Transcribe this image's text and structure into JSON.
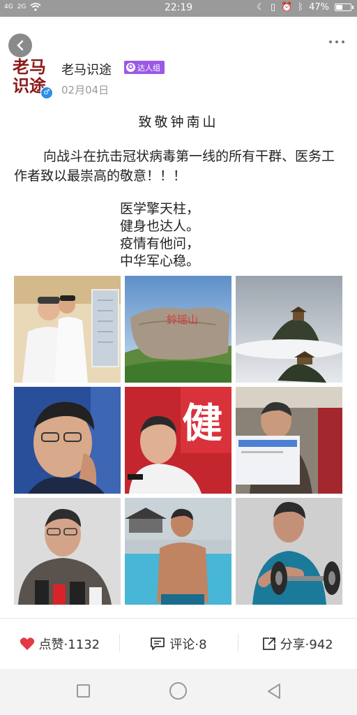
{
  "status_bar": {
    "signal_left": "4G",
    "signal_right": "2G",
    "time": "22:19",
    "battery": "47%",
    "battery_level": 0.47
  },
  "post": {
    "logo_text_line1": "老马",
    "logo_text_line2": "识途",
    "author": "老马识途",
    "badge_label": "达人组",
    "date": "02月04日",
    "title": "致敬钟南山",
    "paragraph": "向战斗在抗击冠状病毒第一线的所有干群、医务工作者致以最崇高的敬意！！！",
    "poem": [
      "医学擎天柱，",
      "健身也达人。",
      "疫情有他问，",
      "中华军心稳。"
    ],
    "photos": [
      "doctor-with-xray-photo",
      "mountain-rock-inscription-photo",
      "misty-mountain-temple-photo",
      "thinking-portrait-photo",
      "smiling-speaker-photo",
      "train-passenger-photo",
      "press-conference-photo",
      "swimming-pool-photo",
      "dumbbell-workout-photo"
    ],
    "rock_inscription": "鈴瑶山",
    "poster_char": "健"
  },
  "actions": {
    "like_label": "点赞·1132",
    "comment_label": "评论·8",
    "share_label": "分享·942"
  },
  "colors": {
    "like_heart": "#e53945",
    "badge": "#9b59e6",
    "logo": "#8b1a1a",
    "status_bar": "#9a9a9a"
  }
}
